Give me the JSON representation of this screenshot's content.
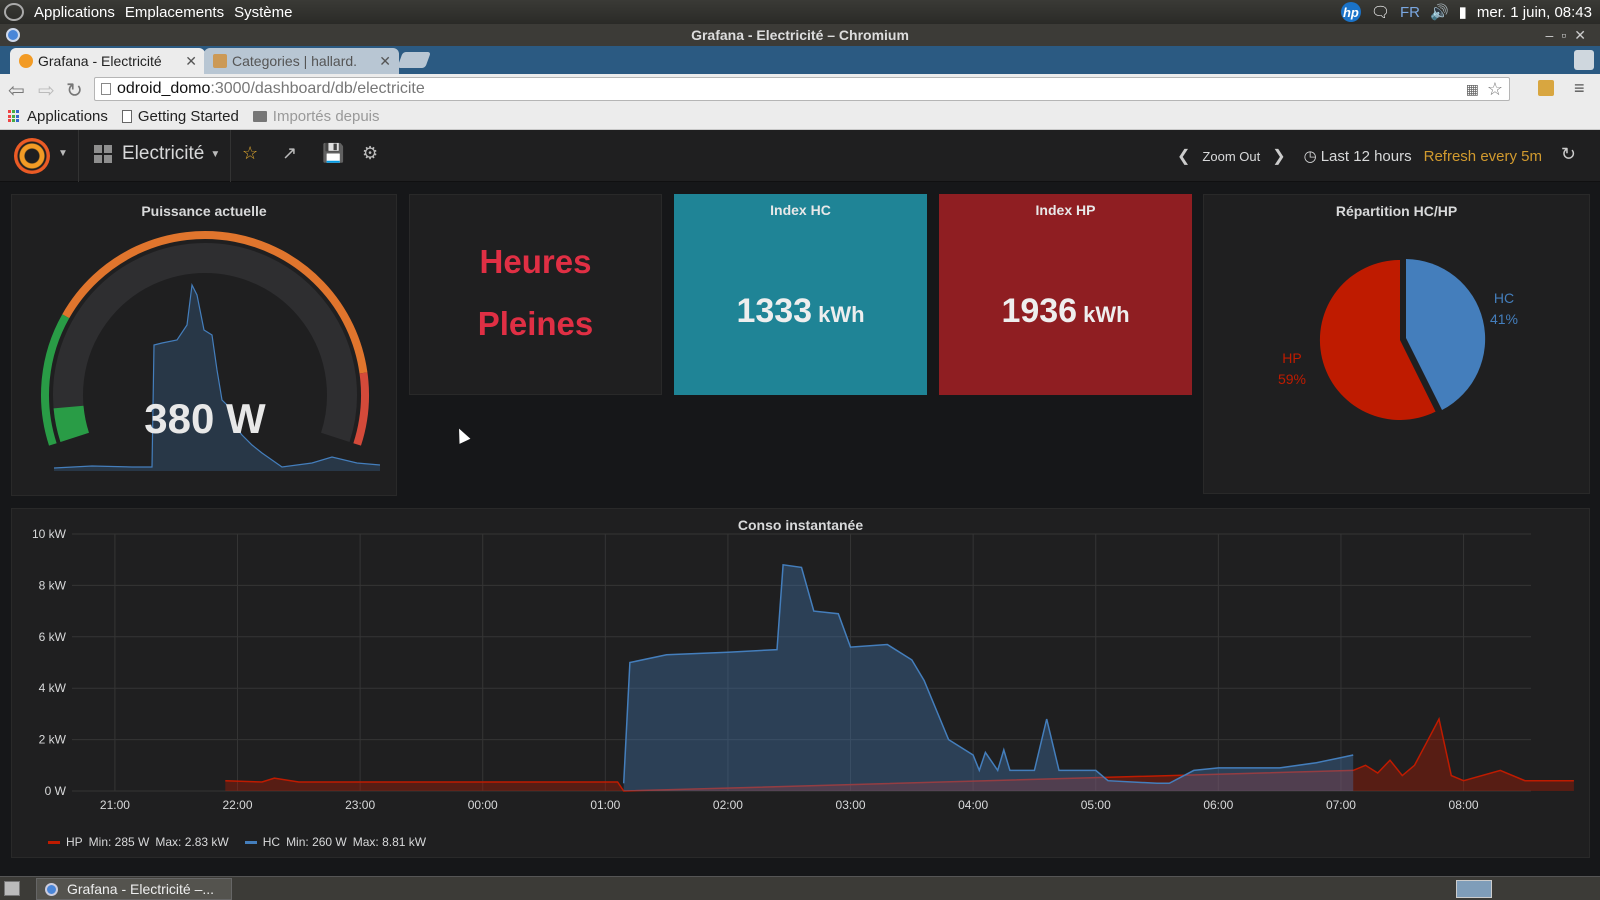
{
  "system_panel": {
    "menus": [
      "Applications",
      "Emplacements",
      "Système"
    ],
    "tray_icons": [
      "hp-icon",
      "chat-icon",
      "volume-icon",
      "battery-icon"
    ],
    "keyboard_layout": "FR",
    "clock": "mer. 1 juin, 08:43"
  },
  "window": {
    "title": "Grafana - Electricité – Chromium"
  },
  "browser": {
    "tabs": [
      {
        "title": "Grafana - Electricité",
        "active": true
      },
      {
        "title": "Categories | hallard.",
        "active": false
      }
    ],
    "url_host": "odroid_domo",
    "url_path": ":3000/dashboard/db/electricite",
    "bookmarks": [
      "Applications",
      "Getting Started",
      "Importés depuis"
    ]
  },
  "grafana": {
    "dashboard_title": "Electricité",
    "zoom_out_label": "Zoom Out",
    "time_range": "Last 12 hours",
    "refresh_label": "Refresh every 5m",
    "colors": {
      "green": "#299c46",
      "orange": "#e0752d",
      "red": "#d44a3a",
      "hc_blue": "#447ebc",
      "hp_red": "#bf1b00",
      "hc_stat": "#1f8496",
      "hp_stat": "#8f1e22"
    }
  },
  "panels": {
    "gauge": {
      "title": "Puissance actuelle",
      "value": "380 W",
      "fraction": 0.06
    },
    "text": {
      "line1": "Heures",
      "line2": "Pleines"
    },
    "index_hc": {
      "title": "Index HC",
      "value": "1333",
      "unit": "kWh"
    },
    "index_hp": {
      "title": "Index HP",
      "value": "1936",
      "unit": "kWh"
    },
    "pie": {
      "title": "Répartition HC/HP",
      "hc_label": "HC",
      "hc_pct": "41%",
      "hp_label": "HP",
      "hp_pct": "59%"
    },
    "graph": {
      "title": "Conso instantanée",
      "legend": [
        {
          "name": "HP",
          "min": "Min: 285 W",
          "max": "Max: 2.83 kW"
        },
        {
          "name": "HC",
          "min": "Min: 260 W",
          "max": "Max: 8.81 kW"
        }
      ]
    }
  },
  "taskbar": {
    "window_item": "Grafana - Electricité –..."
  },
  "chart_data": {
    "type": "area",
    "title": "Conso instantanée",
    "x_ticks": [
      "21:00",
      "22:00",
      "23:00",
      "00:00",
      "01:00",
      "02:00",
      "03:00",
      "04:00",
      "05:00",
      "06:00",
      "07:00",
      "08:00"
    ],
    "y_ticks": [
      "0 W",
      "2 kW",
      "4 kW",
      "6 kW",
      "8 kW",
      "10 kW"
    ],
    "ylim": [
      0,
      10
    ],
    "grid": true,
    "legend_position": "bottom-left",
    "series": [
      {
        "name": "HP",
        "color": "#bf1b00",
        "x": [
          21.9,
          22.2,
          22.3,
          22.5,
          23.0,
          23.5,
          24.0,
          24.5,
          25.1,
          25.15,
          31.1,
          31.2,
          31.3,
          31.4,
          31.5,
          31.6,
          31.7,
          31.8,
          31.9,
          32.0,
          32.3,
          32.5,
          32.9
        ],
        "values": [
          0.4,
          0.35,
          0.5,
          0.35,
          0.35,
          0.35,
          0.35,
          0.35,
          0.35,
          0.0,
          0.8,
          1.0,
          0.7,
          1.2,
          0.6,
          1.0,
          1.9,
          2.8,
          0.6,
          0.4,
          0.8,
          0.4,
          0.4
        ]
      },
      {
        "name": "HC",
        "color": "#447ebc",
        "x": [
          25.15,
          25.2,
          25.5,
          26.0,
          26.4,
          26.45,
          26.6,
          26.7,
          26.9,
          27.0,
          27.3,
          27.5,
          27.6,
          27.8,
          28.0,
          28.05,
          28.1,
          28.2,
          28.25,
          28.3,
          28.5,
          28.6,
          28.7,
          29.0,
          29.1,
          29.5,
          29.6,
          29.8,
          30.0,
          30.5,
          30.8,
          31.0,
          31.1
        ],
        "values": [
          0.3,
          5.0,
          5.3,
          5.4,
          5.5,
          8.8,
          8.7,
          7.0,
          6.9,
          5.6,
          5.7,
          5.1,
          4.3,
          2.0,
          1.4,
          0.8,
          1.5,
          0.8,
          1.6,
          0.8,
          0.8,
          2.8,
          0.8,
          0.8,
          0.4,
          0.3,
          0.3,
          0.8,
          0.9,
          0.9,
          1.1,
          1.3,
          1.4
        ]
      }
    ]
  }
}
